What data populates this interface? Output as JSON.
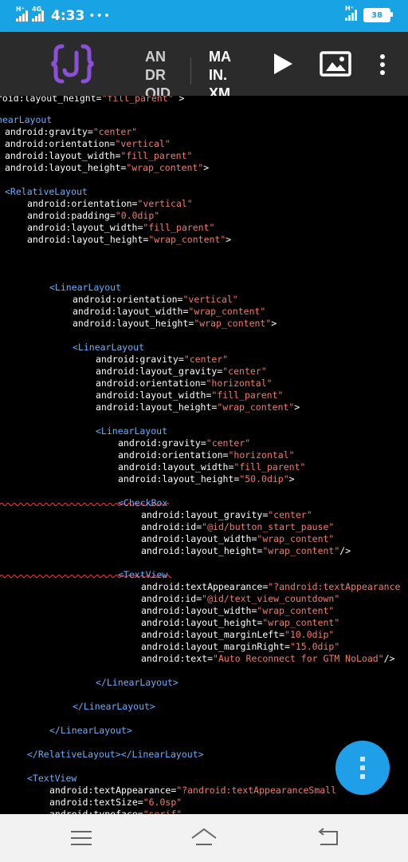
{
  "status_bar": {
    "network_label_1": "H⁺",
    "network_label_2": "4G",
    "time": "4:33",
    "more_dots": "•••",
    "right_network": "H⁺",
    "battery_level": "38"
  },
  "toolbar": {
    "tab_file_1": [
      "AN",
      "DR",
      "OID"
    ],
    "tab_file_2": [
      "MA",
      "IN.",
      "XM"
    ],
    "colors": {
      "logo": "#8b4fd8",
      "toolbar_bg": "#2b2b2b"
    }
  },
  "editor": {
    "colors": {
      "tag": "#6aaefc",
      "attribute": "#ffffff",
      "string": "#f07c6c",
      "error_underline": "#ff3030"
    },
    "lines": [
      [
        [
          "roid:layout_height=",
          "attr"
        ],
        [
          "\"fill_parent\"",
          "str"
        ],
        [
          " >",
          "punct"
        ]
      ],
      [
        [
          "nearLayout",
          "tag"
        ]
      ],
      [
        [
          "android:gravity=",
          "attr"
        ],
        [
          "\"center\"",
          "str"
        ]
      ],
      [
        [
          "android:orientation=",
          "attr"
        ],
        [
          "\"vertical\"",
          "str"
        ]
      ],
      [
        [
          "android:layout_width=",
          "attr"
        ],
        [
          "\"fill_parent\"",
          "str"
        ]
      ],
      [
        [
          "android:layout_height=",
          "attr"
        ],
        [
          "\"wrap_content\"",
          "str"
        ],
        [
          ">",
          "punct"
        ]
      ],
      [
        [
          "<RelativeLayout",
          "tag"
        ]
      ],
      [
        [
          "android:orientation=",
          "attr"
        ],
        [
          "\"vertical\"",
          "str"
        ]
      ],
      [
        [
          "android:padding=",
          "attr"
        ],
        [
          "\"0.0dip\"",
          "str"
        ]
      ],
      [
        [
          "android:layout_width=",
          "attr"
        ],
        [
          "\"fill_parent\"",
          "str"
        ]
      ],
      [
        [
          "android:layout_height=",
          "attr"
        ],
        [
          "\"wrap_content\"",
          "str"
        ],
        [
          ">",
          "punct"
        ]
      ],
      [
        [
          "<LinearLayout",
          "tag"
        ]
      ],
      [
        [
          "android:orientation=",
          "attr"
        ],
        [
          "\"vertical\"",
          "str"
        ]
      ],
      [
        [
          "android:layout_width=",
          "attr"
        ],
        [
          "\"wrap_content\"",
          "str"
        ]
      ],
      [
        [
          "android:layout_height=",
          "attr"
        ],
        [
          "\"wrap_content\"",
          "str"
        ],
        [
          ">",
          "punct"
        ]
      ],
      [
        [
          "<LinearLayout",
          "tag"
        ]
      ],
      [
        [
          "android:gravity=",
          "attr"
        ],
        [
          "\"center\"",
          "str"
        ]
      ],
      [
        [
          "android:layout_gravity=",
          "attr"
        ],
        [
          "\"center\"",
          "str"
        ]
      ],
      [
        [
          "android:orientation=",
          "attr"
        ],
        [
          "\"horizontal\"",
          "str"
        ]
      ],
      [
        [
          "android:layout_width=",
          "attr"
        ],
        [
          "\"fill_parent\"",
          "str"
        ]
      ],
      [
        [
          "android:layout_height=",
          "attr"
        ],
        [
          "\"wrap_content\"",
          "str"
        ],
        [
          ">",
          "punct"
        ]
      ],
      [
        [
          "<LinearLayout",
          "tag"
        ]
      ],
      [
        [
          "android:gravity=",
          "attr"
        ],
        [
          "\"center\"",
          "str"
        ]
      ],
      [
        [
          "android:orientation=",
          "attr"
        ],
        [
          "\"horizontal\"",
          "str"
        ]
      ],
      [
        [
          "android:layout_width=",
          "attr"
        ],
        [
          "\"fill_parent\"",
          "str"
        ]
      ],
      [
        [
          "android:layout_height=",
          "attr"
        ],
        [
          "\"50.0dip\"",
          "str"
        ],
        [
          ">",
          "punct"
        ]
      ],
      [
        [
          "<CheckBox",
          "tag"
        ]
      ],
      [
        [
          "android:layout_gravity=",
          "attr"
        ],
        [
          "\"center\"",
          "str"
        ]
      ],
      [
        [
          "android:id=",
          "attr"
        ],
        [
          "\"@id/button_start_pause\"",
          "str"
        ]
      ],
      [
        [
          "android:layout_width=",
          "attr"
        ],
        [
          "\"wrap_content\"",
          "str"
        ]
      ],
      [
        [
          "android:layout_height=",
          "attr"
        ],
        [
          "\"wrap_content\"",
          "str"
        ],
        [
          "/>",
          "punct"
        ]
      ],
      [
        [
          "<TextView",
          "tag"
        ]
      ],
      [
        [
          "android:textAppearance=",
          "attr"
        ],
        [
          "\"?android:textAppearance",
          "str"
        ]
      ],
      [
        [
          "android:id=",
          "attr"
        ],
        [
          "\"@id/text_view_countdown\"",
          "str"
        ]
      ],
      [
        [
          "android:layout_width=",
          "attr"
        ],
        [
          "\"wrap_content\"",
          "str"
        ]
      ],
      [
        [
          "android:layout_height=",
          "attr"
        ],
        [
          "\"wrap_content\"",
          "str"
        ]
      ],
      [
        [
          "android:layout_marginLeft=",
          "attr"
        ],
        [
          "\"10.0dip\"",
          "str"
        ]
      ],
      [
        [
          "android:layout_marginRight=",
          "attr"
        ],
        [
          "\"15.0dip\"",
          "str"
        ]
      ],
      [
        [
          "android:text=",
          "attr"
        ],
        [
          "\"Auto Reconnect for GTM NoLoad\"",
          "str"
        ],
        [
          "/>",
          "punct"
        ]
      ],
      [
        [
          "</LinearLayout>",
          "tag"
        ]
      ],
      [
        [
          "</LinearLayout>",
          "tag"
        ]
      ],
      [
        [
          "</LinearLayout>",
          "tag"
        ]
      ],
      [
        [
          "</RelativeLayout></LinearLayout>",
          "tag"
        ]
      ],
      [
        [
          "<TextView",
          "tag"
        ]
      ],
      [
        [
          "android:textAppearance=",
          "attr"
        ],
        [
          "\"?android:textAppearanceSmall",
          "str"
        ]
      ],
      [
        [
          "android:textSize=",
          "attr"
        ],
        [
          "\"6.0sp\"",
          "str"
        ]
      ],
      [
        [
          "android:typeface=",
          "attr"
        ],
        [
          "\"serif\"",
          "str"
        ]
      ]
    ]
  }
}
